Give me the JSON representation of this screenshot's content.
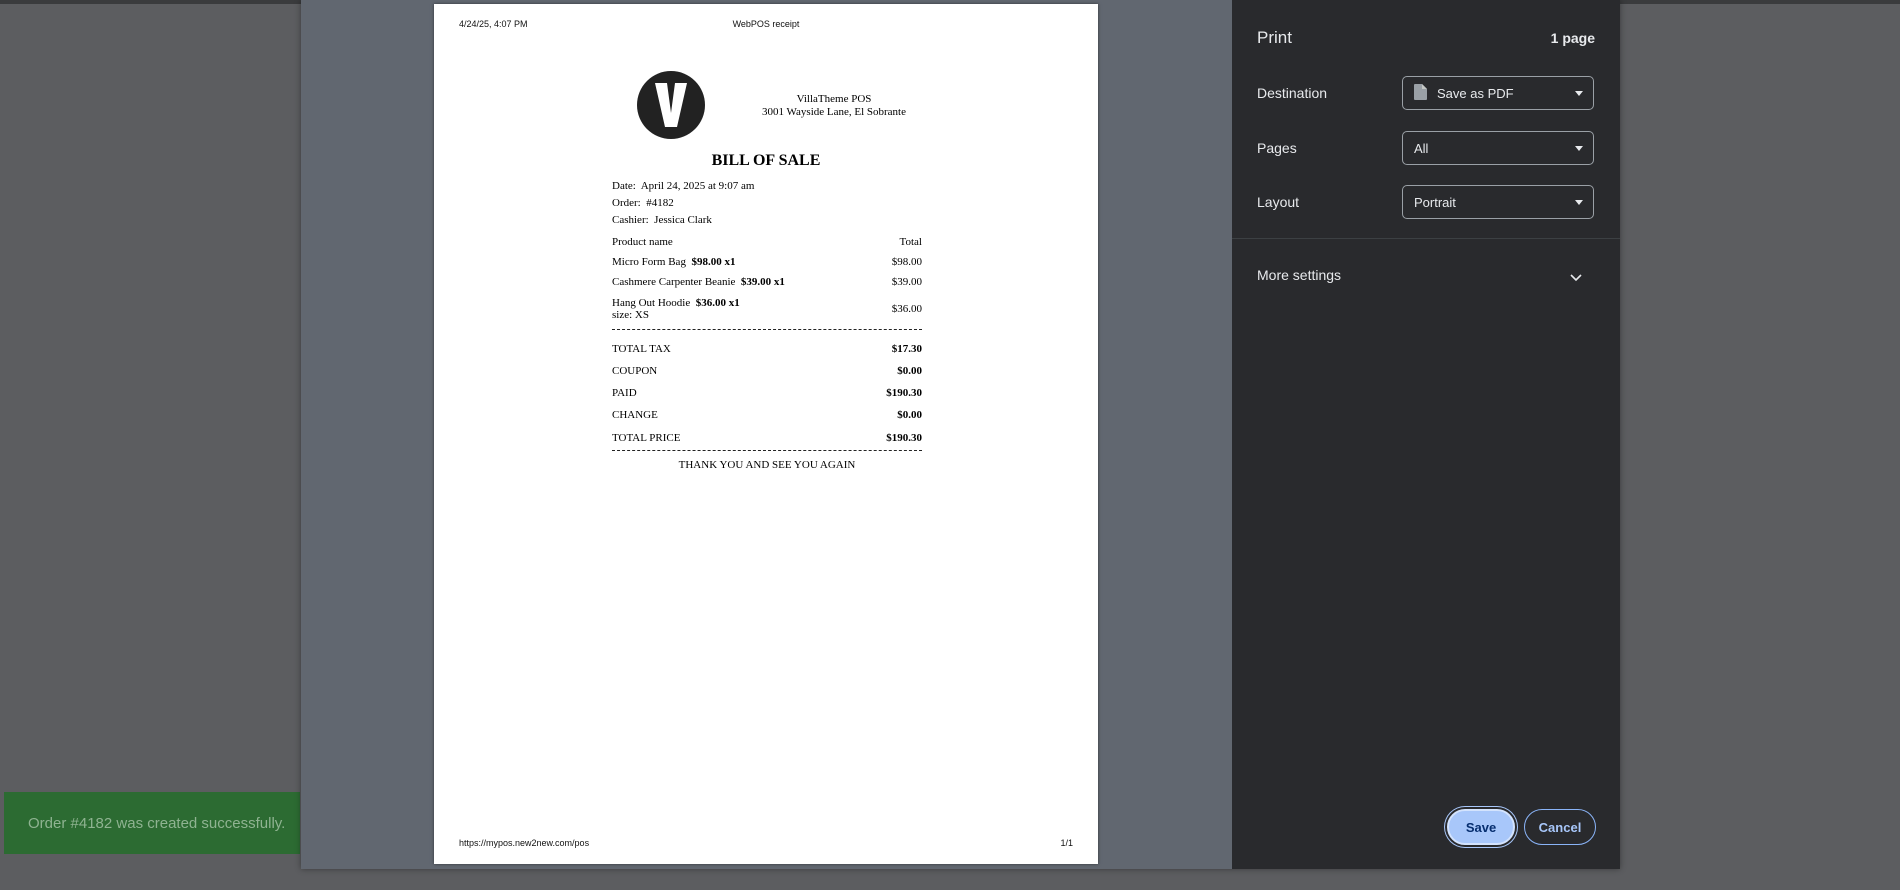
{
  "toast": {
    "text": "Order #4182 was created successfully."
  },
  "receipt": {
    "header_datetime": "4/24/25, 4:07 PM",
    "header_title": "WebPOS receipt",
    "logo_letter": "V",
    "store_name": "VillaTheme POS",
    "store_address": "3001 Wayside Lane, El Sobrante",
    "title": "BILL OF SALE",
    "date_label": "Date:",
    "date_value": "April 24, 2025 at 9:07 am",
    "order_label": "Order:",
    "order_value": "#4182",
    "cashier_label": "Cashier:",
    "cashier_value": "Jessica Clark",
    "col_product": "Product name",
    "col_total": "Total",
    "items": [
      {
        "name": "Micro Form Bag",
        "price_qty": "$98.00 x1",
        "total": "$98.00",
        "variant": ""
      },
      {
        "name": "Cashmere Carpenter Beanie",
        "price_qty": "$39.00 x1",
        "total": "$39.00",
        "variant": ""
      },
      {
        "name": "Hang Out Hoodie",
        "price_qty": "$36.00 x1",
        "total": "$36.00",
        "variant": "size: XS"
      }
    ],
    "totals": [
      {
        "label": "TOTAL TAX",
        "value": "$17.30"
      },
      {
        "label": "COUPON",
        "value": "$0.00"
      },
      {
        "label": "PAID",
        "value": "$190.30"
      },
      {
        "label": "CHANGE",
        "value": "$0.00"
      },
      {
        "label": "TOTAL PRICE",
        "value": "$190.30"
      }
    ],
    "thanks": "THANK YOU AND SEE YOU AGAIN",
    "footer_url": "https://mypos.new2new.com/pos",
    "footer_page": "1/1"
  },
  "print_panel": {
    "title": "Print",
    "page_count": "1 page",
    "destination_label": "Destination",
    "destination_value": "Save as PDF",
    "pages_label": "Pages",
    "pages_value": "All",
    "layout_label": "Layout",
    "layout_value": "Portrait",
    "more_settings": "More settings",
    "save_label": "Save",
    "cancel_label": "Cancel"
  },
  "colors": {
    "panel_bg": "#292a2d",
    "accent": "#a8c7fa",
    "toast_bg": "#2c6b32"
  }
}
